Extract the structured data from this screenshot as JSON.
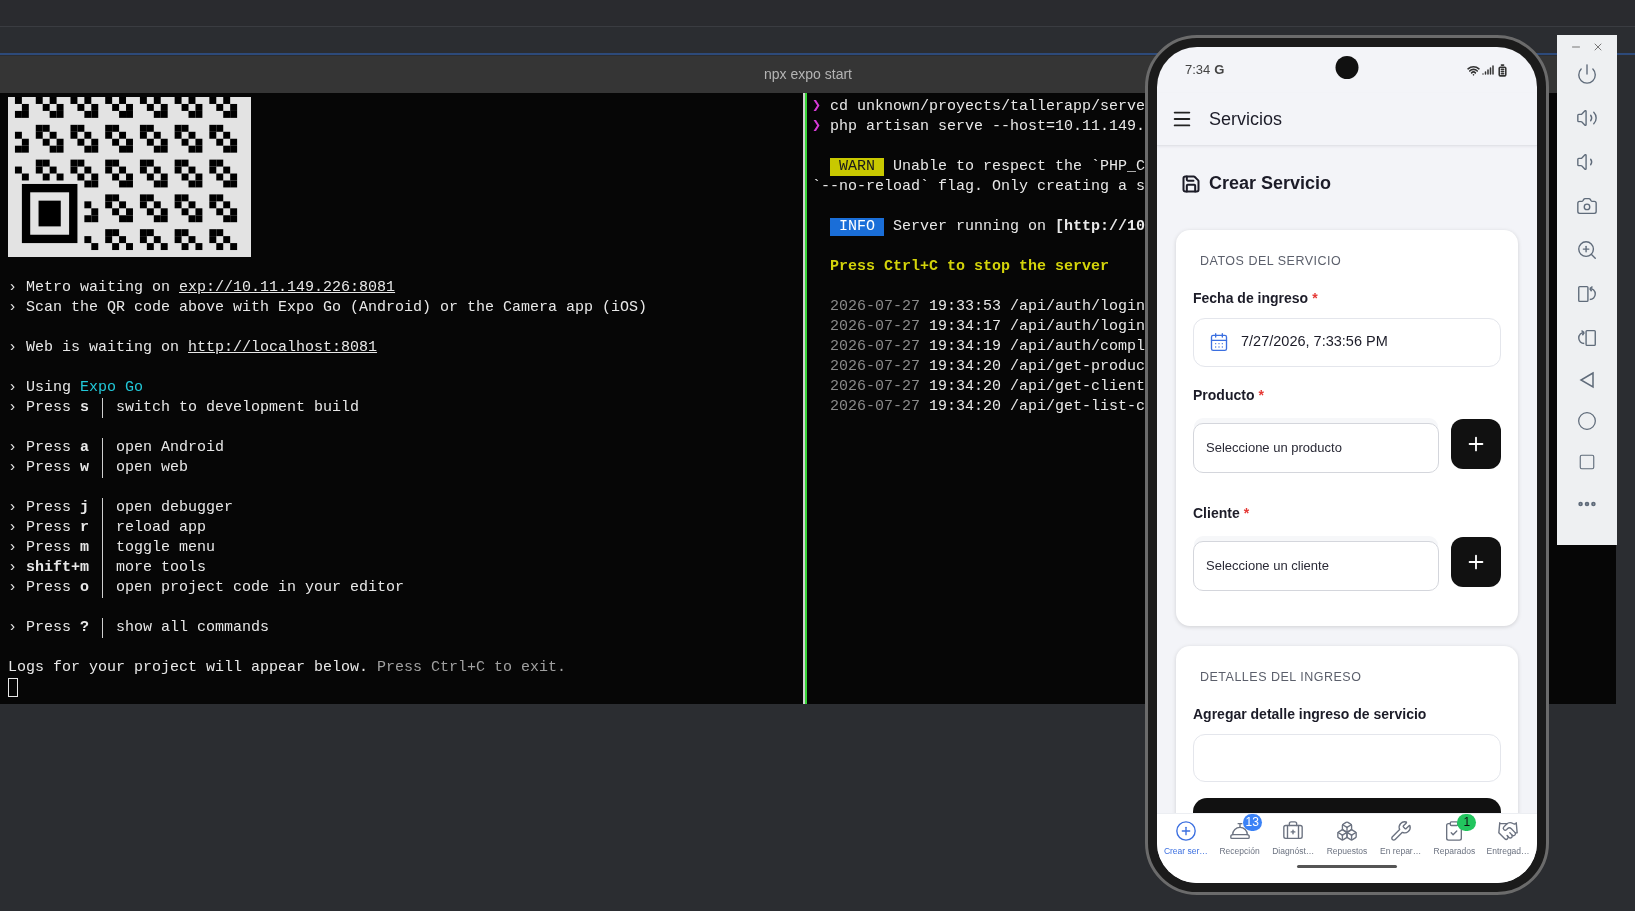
{
  "terminal": {
    "title": "npx expo start",
    "left_pane": {
      "blocks": [
        [
          {
            "kind": "link",
            "bullet": "›",
            "text": "Metro waiting on",
            "url": "exp://10.11.149.226:8081"
          },
          {
            "kind": "text",
            "bullet": "›",
            "text": "Scan the QR code above with Expo Go (Android) or the Camera app (iOS)"
          }
        ],
        [
          {
            "kind": "link",
            "bullet": "›",
            "text": "Web is waiting on",
            "url": "http://localhost:8081"
          }
        ],
        [
          {
            "kind": "accent",
            "bullet": "›",
            "text": "Using",
            "accent": "Expo Go"
          },
          {
            "kind": "key",
            "bullet": "›",
            "press": "Press",
            "key": "s",
            "action": "switch to development build"
          }
        ],
        [
          {
            "kind": "key",
            "bullet": "›",
            "press": "Press",
            "key": "a",
            "action": "open Android"
          },
          {
            "kind": "key",
            "bullet": "›",
            "press": "Press",
            "key": "w",
            "action": "open web"
          }
        ],
        [
          {
            "kind": "key",
            "bullet": "›",
            "press": "Press",
            "key": "j",
            "action": "open debugger"
          },
          {
            "kind": "key",
            "bullet": "›",
            "press": "Press",
            "key": "r",
            "action": "reload app"
          },
          {
            "kind": "key",
            "bullet": "›",
            "press": "Press",
            "key": "m",
            "action": "toggle menu"
          },
          {
            "kind": "key",
            "bullet": "›",
            "key": "shift+m",
            "action": "more tools"
          },
          {
            "kind": "key",
            "bullet": "›",
            "press": "Press",
            "key": "o",
            "action": "open project code in your editor"
          }
        ],
        [
          {
            "kind": "key",
            "bullet": "›",
            "press": "Press",
            "key": "?",
            "action": "show all commands"
          }
        ]
      ],
      "footer": {
        "text": "Logs for your project will appear below.",
        "hint": "Press Ctrl+C to exit."
      }
    },
    "right_pane": {
      "blocks": [
        [
          {
            "kind": "command",
            "prompt": "❯",
            "text": "cd unknown/proyects/tallerapp/serve"
          },
          {
            "kind": "command",
            "prompt": "❯",
            "text": "php artisan serve --host=10.11.149."
          }
        ],
        [
          {
            "kind": "warn",
            "badge": "WARN",
            "text": "Unable to respect the `PHP_C",
            "continuation": "`--no-reload` flag. Only creating a s"
          }
        ],
        [
          {
            "kind": "info",
            "badge": "INFO",
            "text": "Server running on **[http://10**"
          }
        ],
        [
          {
            "kind": "notice",
            "text": "Press Ctrl+C to stop the server"
          }
        ],
        [
          {
            "kind": "log",
            "date": "2026-07-27",
            "time": "19:33:53",
            "path": "/api/auth/login"
          },
          {
            "kind": "log",
            "date": "2026-07-27",
            "time": "19:34:17",
            "path": "/api/auth/login"
          },
          {
            "kind": "log",
            "date": "2026-07-27",
            "time": "19:34:19",
            "path": "/api/auth/compl"
          },
          {
            "kind": "log",
            "date": "2026-07-27",
            "time": "19:34:20",
            "path": "/api/get-produc"
          },
          {
            "kind": "log",
            "date": "2026-07-27",
            "time": "19:34:20",
            "path": "/api/get-client"
          },
          {
            "kind": "log",
            "date": "2026-07-27",
            "time": "19:34:20",
            "path": "/api/get-list-c"
          }
        ]
      ]
    }
  },
  "phone": {
    "status_bar": {
      "time": "7:34",
      "carrier": "G"
    },
    "header": {
      "title": "Servicios"
    },
    "page_title": "Crear Servicio",
    "sections": [
      {
        "heading": "DATOS DEL SERVICIO",
        "fields": [
          {
            "kind": "date",
            "label": "Fecha de ingreso",
            "required_mark": "*",
            "value": "7/27/2026, 7:33:56 PM"
          },
          {
            "kind": "picker",
            "label": "Producto",
            "required_mark": "*",
            "placeholder": "Seleccione un producto"
          },
          {
            "kind": "picker",
            "label": "Cliente",
            "required_mark": "*",
            "placeholder": "Seleccione un cliente"
          }
        ]
      },
      {
        "heading": "DETALLES DEL INGRESO",
        "fields": [
          {
            "kind": "textarea",
            "label": "Agregar detalle ingreso de servicio"
          }
        ]
      }
    ],
    "bottom_nav": [
      {
        "label": "Crear ser…",
        "selected": true
      },
      {
        "label": "Recepción",
        "selected": false,
        "badge": {
          "text": "13",
          "color": "#3b82f6"
        }
      },
      {
        "label": "Diagnóst…",
        "selected": false
      },
      {
        "label": "Repuestos",
        "selected": false
      },
      {
        "label": "En repar…",
        "selected": false
      },
      {
        "label": "Reparados",
        "selected": false,
        "badge": {
          "text": "1",
          "color": "#22c55e"
        }
      },
      {
        "label": "Entregad…",
        "selected": false
      }
    ]
  }
}
